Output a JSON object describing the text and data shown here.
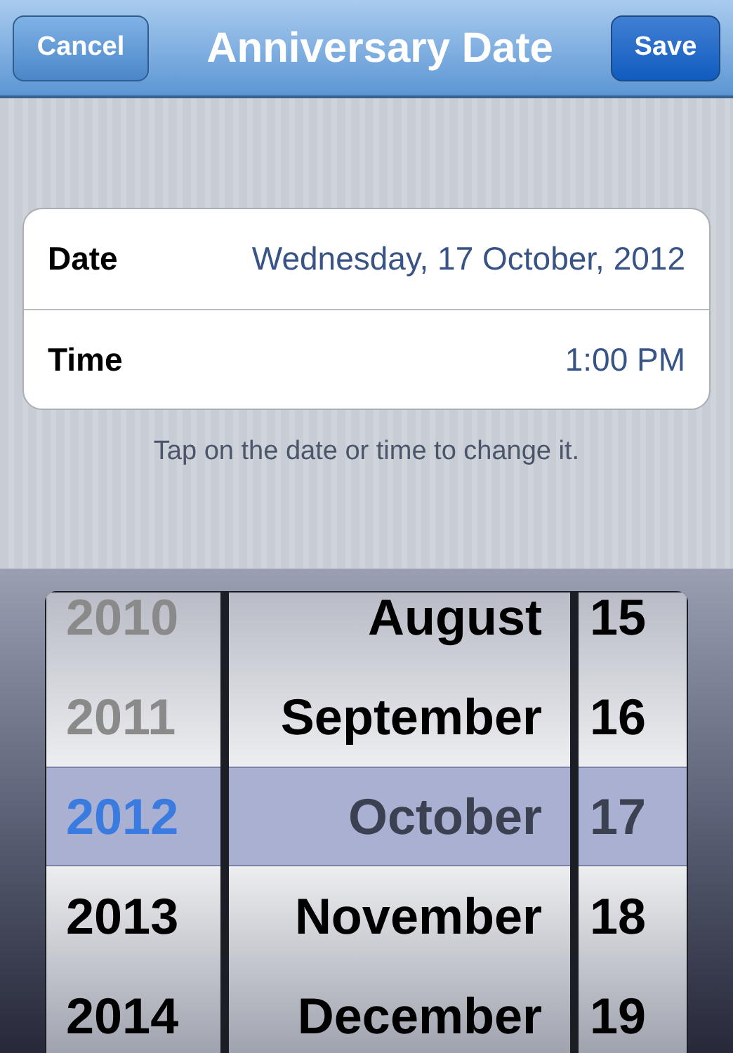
{
  "nav_bar": {
    "title": "Anniversary Date",
    "cancel_button": "Cancel",
    "save_button": "Save"
  },
  "fields": [
    {
      "label": "Date",
      "value": "Wednesday, 17 October, 2012"
    },
    {
      "label": "Time",
      "value": "1:00 PM"
    }
  ],
  "hint": "Tap on the date or time to change it.",
  "picker": {
    "columns": [
      {
        "kind": "year",
        "items": [
          {
            "label": "2010",
            "selected": false,
            "disabled": true
          },
          {
            "label": "2011",
            "selected": false,
            "disabled": true
          },
          {
            "label": "2012",
            "selected": true,
            "disabled": false
          },
          {
            "label": "2013",
            "selected": false,
            "disabled": false
          },
          {
            "label": "2014",
            "selected": false,
            "disabled": false
          }
        ]
      },
      {
        "kind": "month",
        "items": [
          {
            "label": "August",
            "selected": false,
            "disabled": false
          },
          {
            "label": "September",
            "selected": false,
            "disabled": false
          },
          {
            "label": "October",
            "selected": true,
            "disabled": false
          },
          {
            "label": "November",
            "selected": false,
            "disabled": false
          },
          {
            "label": "December",
            "selected": false,
            "disabled": false
          }
        ]
      },
      {
        "kind": "day",
        "items": [
          {
            "label": "15",
            "selected": false,
            "disabled": false
          },
          {
            "label": "16",
            "selected": false,
            "disabled": false
          },
          {
            "label": "17",
            "selected": true,
            "disabled": false
          },
          {
            "label": "18",
            "selected": false,
            "disabled": false
          },
          {
            "label": "19",
            "selected": false,
            "disabled": false
          }
        ]
      }
    ]
  }
}
